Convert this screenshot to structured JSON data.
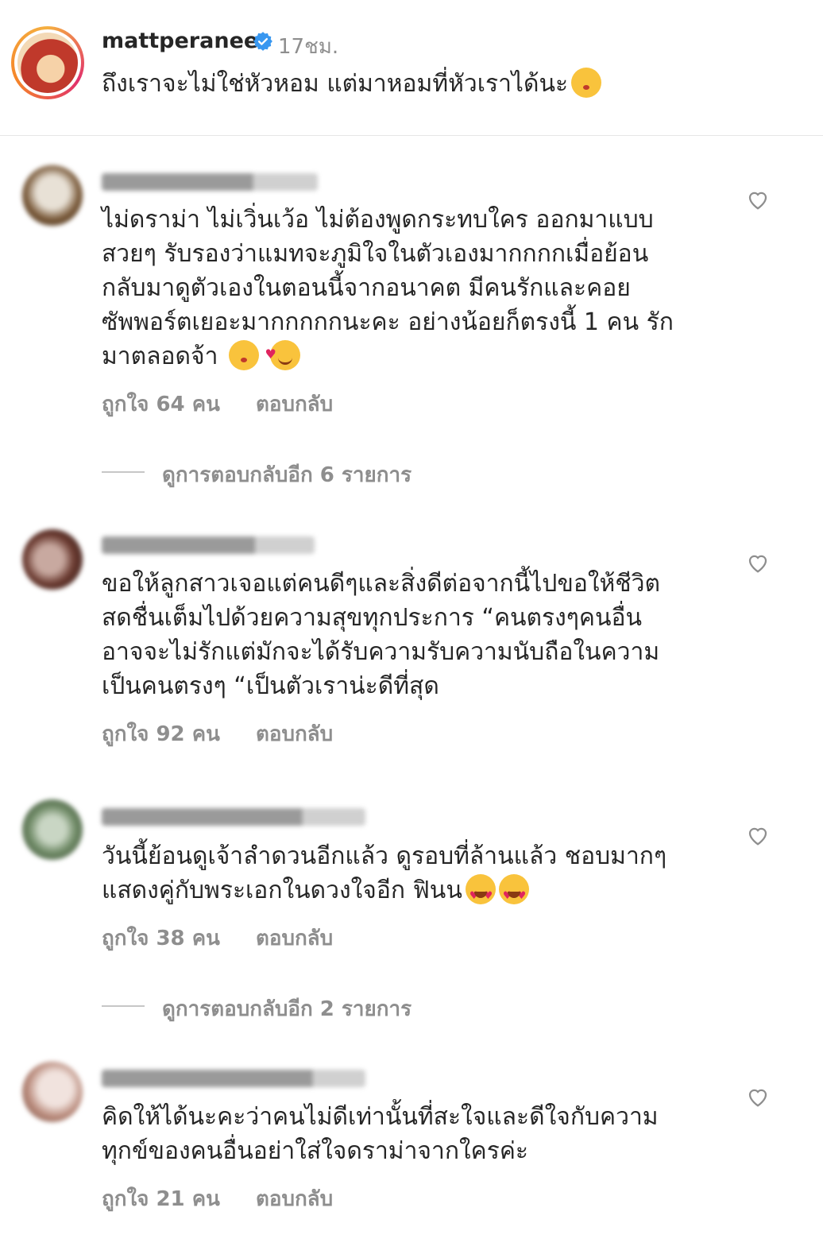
{
  "caption_header": {
    "username": "mattperanee",
    "time": "17ชม.",
    "caption": "ถึงเราจะไม่ใช่หัวหอม แต่มาหอมที่หัวเราได้นะ",
    "caption_emoji": "kissing-closed-eyes-emoji"
  },
  "comments": [
    {
      "username": "",
      "lines": [
        "ไม่ดราม่า ไม่เวิ่นเว้อ ไม่ต้องพูดกระทบใคร ออกมาแบบ",
        "สวยๆ รับรองว่าแมทจะภูมิใจในตัวเองมากกกกเมื่อย้อน",
        "กลับมาดูตัวเองในตอนนี้จากอนาคต มีคนรักและคอย",
        "ซัพพอร์ตเยอะมากกกกกนะคะ อย่างน้อยก็ตรงนี้ 1 คน รัก",
        "มาตลอดจ้า"
      ],
      "emojis": [
        "face-blowing-kiss-emoji",
        "smiling-face-with-hearts-emoji"
      ],
      "likes": "ถูกใจ 64 คน",
      "reply": "ตอบกลับ",
      "view_replies": "ดูการตอบกลับอีก 6 รายการ"
    },
    {
      "username": "",
      "lines": [
        "ขอให้ลูกสาวเจอแต่คนดีๆและสิ่งดีต่อจากนี้ไปขอให้ชีวิต",
        "สดชื่นเต็มไปด้วยความสุขทุกประการ “คนตรงๆคนอื่น",
        "อาจจะไม่รักแต่มักจะได้รับความรับความนับถือในความ",
        "เป็นคนตรงๆ “เป็นตัวเราน่ะดีที่สุด"
      ],
      "emojis": [],
      "likes": "ถูกใจ 92 คน",
      "reply": "ตอบกลับ",
      "view_replies": ""
    },
    {
      "username": "",
      "lines": [
        "วันนี้ย้อนดูเจ้าลำดวนอีกแล้ว ดูรอบที่ล้านแล้ว ชอบมากๆ",
        "แสดงคู่กับพระเอกในดวงใจอีก ฟินน"
      ],
      "emojis": [
        "heart-eyes-emoji",
        "heart-eyes-emoji"
      ],
      "likes": "ถูกใจ 38 คน",
      "reply": "ตอบกลับ",
      "view_replies": "ดูการตอบกลับอีก 2 รายการ"
    },
    {
      "username": "",
      "lines": [
        "คิดให้ได้นะคะว่าคนไม่ดีเท่านั้นที่สะใจและดีใจกับความ",
        "ทุกข์ของคนอื่นอย่าใส่ใจดราม่าจากใครค่ะ"
      ],
      "emojis": [],
      "likes": "ถูกใจ 21 คน",
      "reply": "ตอบกลับ",
      "view_replies": ""
    }
  ],
  "colors": {
    "text": "#262626",
    "secondary": "#8e8e8e",
    "verified": "#3897f0",
    "divider": "#e6e6e6"
  }
}
